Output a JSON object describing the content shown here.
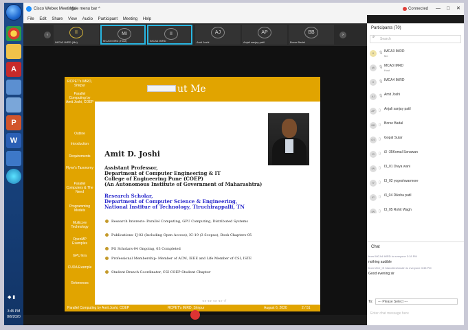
{
  "taskbar": {
    "clock_time": "3:45 PM",
    "clock_date": "8/6/2020",
    "apps": [
      {
        "icon": "windows-start-icon"
      },
      {
        "icon": "chrome-icon"
      },
      {
        "icon": "explorer-icon"
      },
      {
        "icon": "acrobat-icon"
      },
      {
        "icon": "notepad-icon"
      },
      {
        "icon": "network-icon"
      },
      {
        "icon": "powerpoint-icon"
      },
      {
        "icon": "word-icon"
      },
      {
        "icon": "calculator-icon"
      },
      {
        "icon": "webex-icon"
      }
    ]
  },
  "window": {
    "title": "Cisco Webex Meetings",
    "hide_menu": "Hide menu bar ^",
    "status": "Connected",
    "menu": [
      "File",
      "Edit",
      "Share",
      "View",
      "Audio",
      "Participant",
      "Meeting",
      "Help"
    ]
  },
  "strip": {
    "tiles": [
      {
        "initials": "II",
        "name": "IMCA3 IMRD (Me)",
        "gold": true,
        "selected": false
      },
      {
        "initials": "MI",
        "name": "MCA3 IMRD (Host)",
        "gold": false,
        "selected": true
      },
      {
        "initials": "II",
        "name": "IMCA4 IMRD",
        "gold": false,
        "selected": true
      },
      {
        "initials": "AJ",
        "name": "Amit Joshi",
        "gold": false,
        "selected": false
      },
      {
        "initials": "AP",
        "name": "Anjali sanjay patil",
        "gold": false,
        "selected": false
      },
      {
        "initials": "BB",
        "name": "Borse Badal",
        "gold": false,
        "selected": false
      }
    ]
  },
  "slide": {
    "title": "ut Me",
    "sidebar": [
      "RCPET's IMRD, Shirpur",
      "Parallel Computing by Amit Joshi, COEP",
      "Outline",
      "Introduction",
      "Requirements",
      "Flynn's Taxonomy",
      "Parallel Computers & The Need",
      "Programming Models",
      "Multicore Technology",
      "OpenMP Examples",
      "GPU Era",
      "CUDA Example",
      "References"
    ],
    "name": "Amit D. Joshi",
    "lines": [
      "Assistant Professor,",
      "Department of Computer Engineering & IT",
      "College of Engineering Pune (COEP)",
      "(An Autonomous Institute of Government of Maharashtra)"
    ],
    "blue_lines": [
      "Research Scholar,",
      "Department of Computer Science & Engineering,",
      "National Institue of Technology, Tiruchirappalli, TN"
    ],
    "bullets": [
      "Research Interests- Parallel Computing, GPU Computing, Distributed Systems",
      "Publications- IJ-02 (Including Open Access), IC-19 (3 Scopus), Book Chapters-05",
      "PG Scholars-04 Ongoing, 03 Completed",
      "Professional Membership- Member of ACM, IEEE and Life Member of CSI, ISTE",
      "Student Branch Coordinator, CSI COEP Student Chapter"
    ],
    "footer": {
      "left": "Parallel Computing by Amit Joshi, COEP",
      "center": "RCPET's IMRD, Shirpur",
      "date": "August 6, 2020",
      "page": "2 / 51"
    }
  },
  "participants": {
    "header": "Participants (70)",
    "search_placeholder": "Search",
    "list": [
      {
        "initials": "II",
        "name": "IMCA3 IMRD",
        "sub": "Me",
        "gold": true
      },
      {
        "initials": "MI",
        "name": "MCA3 IMRD",
        "sub": "Host",
        "gold": false
      },
      {
        "initials": "II",
        "name": "IMCA4 IMRD",
        "sub": "",
        "gold": false
      },
      {
        "initials": "AJ",
        "name": "Amit Joshi",
        "sub": "",
        "gold": false
      },
      {
        "initials": "AP",
        "name": "Anjali sanjay patil",
        "sub": "",
        "gold": false
      },
      {
        "initials": "BB",
        "name": "Borse Badal",
        "sub": "",
        "gold": false
      },
      {
        "initials": "GS",
        "name": "Gopal Sutar",
        "sub": "",
        "gold": false
      },
      {
        "initials": "IS",
        "name": "i3 -35Komal Sonawan",
        "sub": "",
        "gold": false
      },
      {
        "initials": "IW",
        "name": "I3_01 Divya wani",
        "sub": "",
        "gold": false
      },
      {
        "initials": "IY",
        "name": "I3_02 yogeshwarmore",
        "sub": "",
        "gold": false
      },
      {
        "initials": "IP",
        "name": "i3_04 Diksha patil",
        "sub": "",
        "gold": false
      },
      {
        "initials": "IW",
        "name": "I3_05 Rohit Wagh",
        "sub": "",
        "gold": false
      }
    ]
  },
  "chat": {
    "header": "Chat",
    "messages": [
      {
        "from": "from IMCA4 IMRD to everyone   3:18 PM",
        "text": "nothing audible"
      },
      {
        "from": "from MCJ_IS ManoDeshmukh to everyone   3:38 PM",
        "text": "Good evening sir"
      }
    ],
    "to_label": "To:",
    "to_value": "--- Please Select ---",
    "input_placeholder": "Enter chat message here"
  }
}
